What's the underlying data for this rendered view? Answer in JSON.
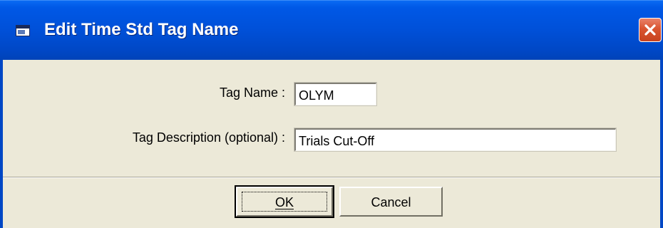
{
  "window": {
    "title": "Edit Time Std Tag Name",
    "app_icon": "window-app-icon",
    "close_icon": "close-icon",
    "colors": {
      "titlebar": "#0050d8",
      "face": "#ece9d8",
      "close": "#d95430"
    }
  },
  "form": {
    "tag_name_label": "Tag Name :",
    "tag_name_value": "OLYM",
    "tag_description_label": "Tag Description (optional) :",
    "tag_description_value": "Trials Cut-Off"
  },
  "buttons": {
    "ok_label": "OK",
    "cancel_label": "Cancel"
  }
}
